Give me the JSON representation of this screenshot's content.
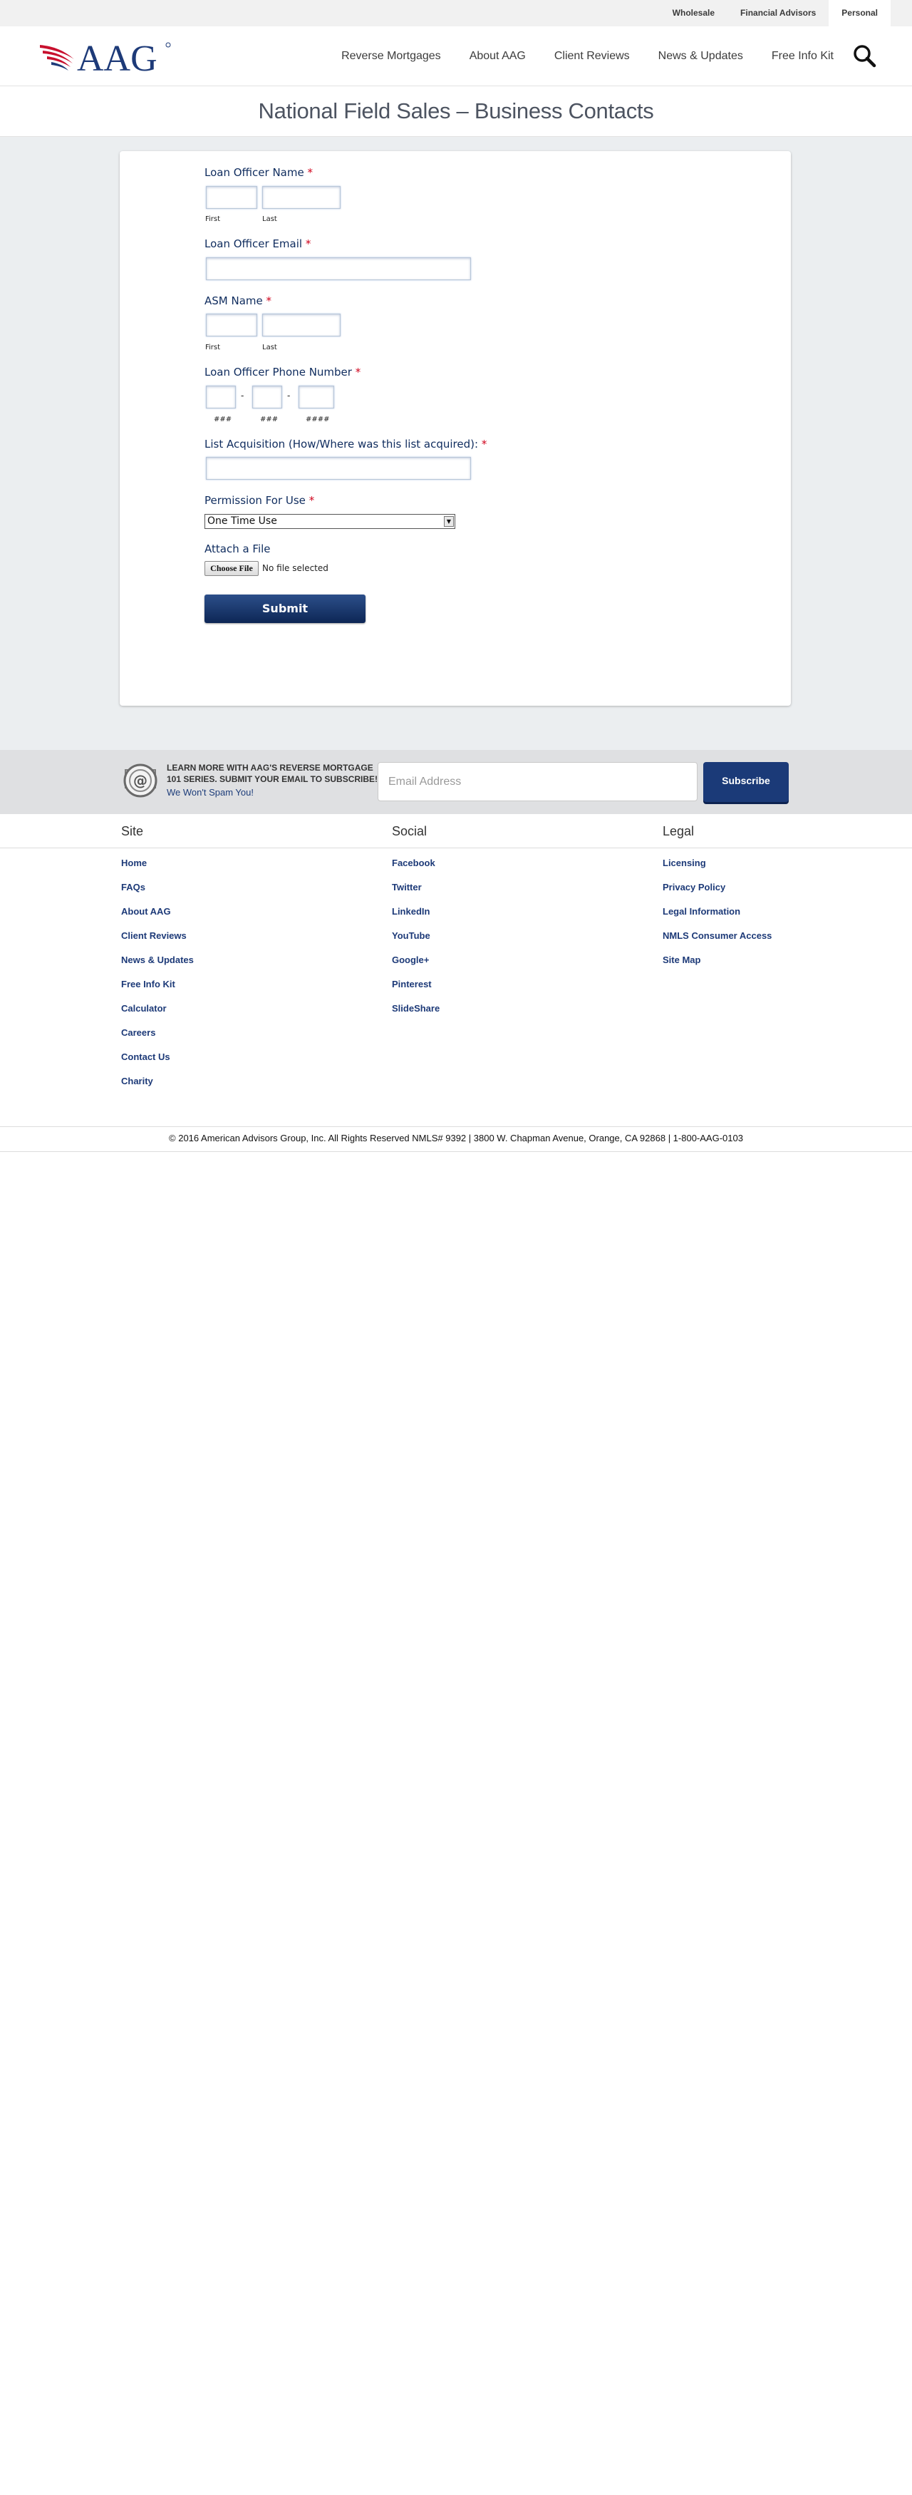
{
  "util_nav": {
    "items": [
      {
        "label": "Wholesale",
        "active": false
      },
      {
        "label": "Financial Advisors",
        "active": false
      },
      {
        "label": "Personal",
        "active": true
      }
    ]
  },
  "header": {
    "logo_text": "AAG",
    "nav": [
      "Reverse Mortgages",
      "About AAG",
      "Client Reviews",
      "News & Updates",
      "Free Info Kit"
    ],
    "search_icon": "search-icon"
  },
  "page": {
    "title": "National Field Sales – Business Contacts"
  },
  "form": {
    "required_mark": "*",
    "loan_officer_name": {
      "label": "Loan Officer Name",
      "first": "First",
      "last": "Last"
    },
    "loan_officer_email": {
      "label": "Loan Officer Email"
    },
    "asm_name": {
      "label": "ASM Name",
      "first": "First",
      "last": "Last"
    },
    "phone": {
      "label": "Loan Officer Phone Number",
      "dash": "-",
      "hint1": "###",
      "hint2": "###",
      "hint3": "####"
    },
    "list_acquisition": {
      "label": "List Acquisition (How/Where was this list acquired):"
    },
    "permission": {
      "label": "Permission For Use",
      "selected": "One Time Use"
    },
    "attach": {
      "label": "Attach a File",
      "button": "Choose File",
      "status": "No file selected"
    },
    "submit": "Submit"
  },
  "subscribe": {
    "line1": "LEARN MORE WITH AAG'S REVERSE MORTGAGE",
    "line2": "101 SERIES. SUBMIT YOUR EMAIL TO SUBSCRIBE!",
    "spam": "We Won't Spam You!",
    "email_placeholder": "Email Address",
    "button": "Subscribe"
  },
  "footer": {
    "site": {
      "heading": "Site",
      "links": [
        "Home",
        "FAQs",
        "About AAG",
        "Client Reviews",
        "News & Updates",
        "Free Info Kit",
        "Calculator",
        "Careers",
        "Contact Us",
        "Charity"
      ]
    },
    "social": {
      "heading": "Social",
      "links": [
        "Facebook",
        "Twitter",
        "LinkedIn",
        "YouTube",
        "Google+",
        "Pinterest",
        "SlideShare"
      ]
    },
    "legal": {
      "heading": "Legal",
      "links": [
        "Licensing",
        "Privacy Policy",
        "Legal Information",
        "NMLS Consumer Access",
        "Site Map"
      ]
    },
    "copyright": "© 2016 American Advisors Group, Inc. All Rights Reserved NMLS# 9392 | 3800 W. Chapman Avenue, Orange, CA 92868 | 1-800-AAG-0103"
  },
  "colors": {
    "brand_navy": "#1d3a78",
    "brand_red": "#c8102e",
    "required_red": "#d0021b"
  }
}
